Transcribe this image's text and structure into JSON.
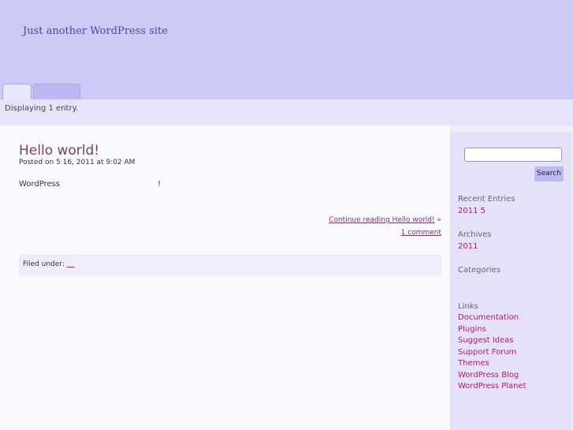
{
  "header": {
    "tagline": "Just another WordPress site",
    "tabs": [
      {
        "label": ""
      },
      {
        "label": ""
      }
    ]
  },
  "subbar": {
    "display_count": "Displaying 1 entry."
  },
  "post": {
    "title": "Hello world!",
    "meta": "Posted on 5  16, 2011 at 9:02 AM",
    "body_left": "WordPress",
    "body_right": "!",
    "continue_link": "Continue reading Hello world!",
    "continue_arrow": "»",
    "comments_link": "1 comment",
    "filed_label": "Filed under:",
    "filed_link": "__"
  },
  "sidebar": {
    "search": {
      "value": "",
      "button_label": "Search"
    },
    "recent_entries": {
      "heading": "Recent Entries",
      "items": [
        "2011 5"
      ]
    },
    "archives": {
      "heading": "Archives",
      "items": [
        "2011"
      ]
    },
    "categories": {
      "heading": "Categories"
    },
    "links": {
      "heading": "Links",
      "items": [
        "Documentation",
        "Plugins",
        "Suggest Ideas",
        "Support Forum",
        "Themes",
        "WordPress Blog",
        "WordPress Planet"
      ]
    }
  },
  "colors": {
    "header_bg": "#cdcaf8",
    "sidebar_bg": "#e4e2f8",
    "title_color": "#7e3b66",
    "link_color": "#c0146f"
  }
}
